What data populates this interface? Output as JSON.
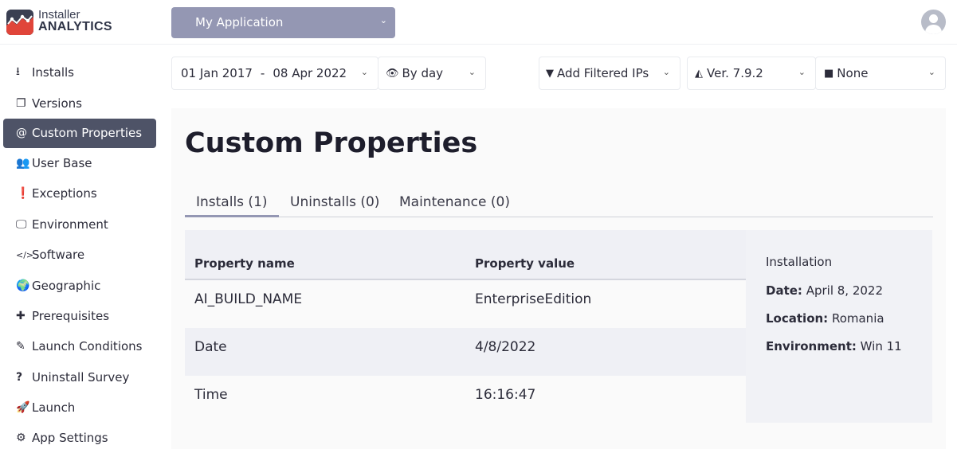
{
  "brand": {
    "line1": "Installer",
    "line2": "ANALYTICS"
  },
  "app_select": {
    "value": "My Application"
  },
  "sidebar": {
    "items": [
      {
        "label": "Installs",
        "icon": "download-icon",
        "glyph": "⭳"
      },
      {
        "label": "Versions",
        "icon": "versions-icon",
        "glyph": "❐"
      },
      {
        "label": "Custom Properties",
        "icon": "at-icon",
        "glyph": "@",
        "active": true
      },
      {
        "label": "User Base",
        "icon": "users-icon",
        "glyph": "👥"
      },
      {
        "label": "Exceptions",
        "icon": "exclamation-icon",
        "glyph": "❗"
      },
      {
        "label": "Environment",
        "icon": "monitor-icon",
        "glyph": "🖵"
      },
      {
        "label": "Software",
        "icon": "code-icon",
        "glyph": "</>"
      },
      {
        "label": "Geographic",
        "icon": "globe-icon",
        "glyph": "🌍"
      },
      {
        "label": "Prerequisites",
        "icon": "puzzle-icon",
        "glyph": "✚"
      },
      {
        "label": "Launch Conditions",
        "icon": "edit-icon",
        "glyph": "✎"
      },
      {
        "label": "Uninstall Survey",
        "icon": "question-icon",
        "glyph": "?"
      },
      {
        "label": "Launch",
        "icon": "rocket-icon",
        "glyph": "🚀"
      },
      {
        "label": "App Settings",
        "icon": "gear-icon",
        "glyph": "⚙"
      }
    ]
  },
  "filters": {
    "date_from": "01 Jan 2017",
    "date_sep": "-",
    "date_to": "08 Apr 2022",
    "granularity": "By day",
    "ip_filter": "Add Filtered IPs",
    "version": "Ver. 7.9.2",
    "folder": "None"
  },
  "page": {
    "title": "Custom Properties"
  },
  "tabs": [
    {
      "label": "Installs (1)",
      "active": true
    },
    {
      "label": "Uninstalls (0)"
    },
    {
      "label": "Maintenance (0)"
    }
  ],
  "table": {
    "headers": {
      "name": "Property name",
      "value": "Property value"
    },
    "rows": [
      {
        "name": "AI_BUILD_NAME",
        "value": "EnterpriseEdition"
      },
      {
        "name": "Date",
        "value": "4/8/2022"
      },
      {
        "name": "Time",
        "value": "16:16:47"
      }
    ]
  },
  "info": {
    "title": "Installation",
    "date_label": "Date:",
    "date_value": "April 8, 2022",
    "location_label": "Location:",
    "location_value": "Romania",
    "environment_label": "Environment:",
    "environment_value": "Win 11"
  },
  "colors": {
    "accent": "#9497b3",
    "active_nav": "#4e5367",
    "brand_red": "#e0453a"
  }
}
